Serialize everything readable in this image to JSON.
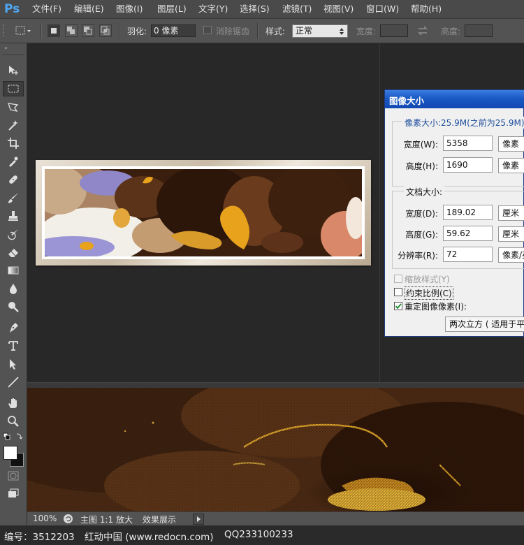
{
  "app": {
    "logo": "Ps"
  },
  "menu": [
    "文件(F)",
    "编辑(E)",
    "图像(I)",
    "图层(L)",
    "文字(Y)",
    "选择(S)",
    "滤镜(T)",
    "视图(V)",
    "窗口(W)",
    "帮助(H)"
  ],
  "options_bar": {
    "feather_label": "羽化:",
    "feather_value": "0 像素",
    "antialias_label": "消除锯齿",
    "style_label": "样式:",
    "style_value": "正常",
    "width_label": "宽度:",
    "height_label": "高度:"
  },
  "tools": [
    "move-tool",
    "marquee-tool",
    "lasso-tool",
    "magic-wand-tool",
    "crop-tool",
    "eyedropper-tool",
    "healing-brush-tool",
    "brush-tool",
    "clone-stamp-tool",
    "history-brush-tool",
    "eraser-tool",
    "gradient-tool",
    "blur-tool",
    "dodge-tool",
    "pen-tool",
    "type-tool",
    "path-selection-tool",
    "line-tool",
    "hand-tool",
    "zoom-tool"
  ],
  "dialog": {
    "title": "图像大小",
    "pixel_dimensions": "像素大小:25.9M(之前为25.9M)",
    "pixel_width_label": "宽度(W):",
    "pixel_width_value": "5358",
    "pixel_width_unit": "像素",
    "pixel_height_label": "高度(H):",
    "pixel_height_value": "1690",
    "pixel_height_unit": "像素",
    "document_size_title": "文档大小:",
    "doc_width_label": "宽度(D):",
    "doc_width_value": "189.02",
    "doc_width_unit": "厘米",
    "doc_height_label": "高度(G):",
    "doc_height_value": "59.62",
    "doc_height_unit": "厘米",
    "resolution_label": "分辨率(R):",
    "resolution_value": "72",
    "resolution_unit": "像素/英",
    "scale_styles": "缩放样式(Y)",
    "constrain_proportions": "约束比例(C)",
    "resample_image": "重定图像像素(I):",
    "resample_method": "两次立方 ( 适用于平"
  },
  "status_bar": {
    "zoom": "100%",
    "tab_label": "主图 1:1 放大",
    "effect_label": "效果展示"
  },
  "footer": {
    "id_text": "编号：3512203",
    "site_text": "红动中国 (www.redocn.com)",
    "qq_text": "QQ233100233"
  },
  "colors": {
    "dialog_title": "#1b59c4",
    "ps_blue": "#4fa6f2",
    "gold": "#e8a21c"
  }
}
